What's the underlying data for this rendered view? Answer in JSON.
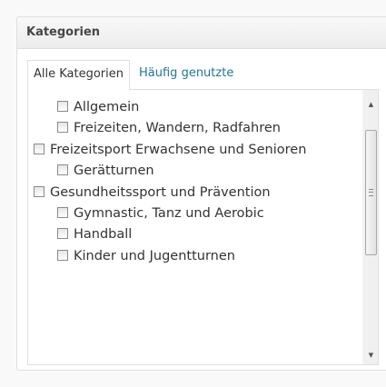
{
  "panel": {
    "title": "Kategorien"
  },
  "tabs": [
    {
      "label": "Alle Kategorien",
      "active": true
    },
    {
      "label": "Häufig genutzte",
      "active": false
    }
  ],
  "categories": [
    {
      "label": "Allgemein",
      "checked": false
    },
    {
      "label": "Freizeiten, Wandern, Radfahren",
      "checked": false
    },
    {
      "label": "Freizeitsport Erwachsene und Senioren",
      "checked": false
    },
    {
      "label": "Gerätturnen",
      "checked": false
    },
    {
      "label": "Gesundheitssport und Prävention",
      "checked": false
    },
    {
      "label": "Gymnastic, Tanz und Aerobic",
      "checked": false
    },
    {
      "label": "Handball",
      "checked": false
    },
    {
      "label": "Kinder und Jugentturnen",
      "checked": false
    }
  ],
  "colors": {
    "link": "#21759b",
    "border": "#dfdfdf",
    "title_text": "#464646"
  }
}
